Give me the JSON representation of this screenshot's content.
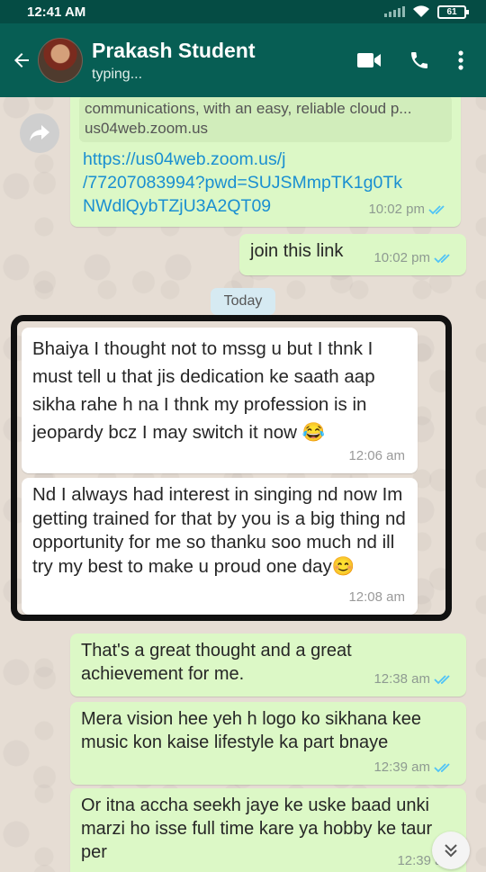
{
  "status_bar": {
    "time": "12:41 AM",
    "battery": "61"
  },
  "header": {
    "contact_name": "Prakash Student",
    "contact_status": "typing..."
  },
  "link_preview": {
    "description": "communications, with an easy, reliable cloud p...",
    "domain": "us04web.zoom.us"
  },
  "messages": [
    {
      "id": "link",
      "text_lines": [
        "https://us04web.zoom.us/j",
        "/77207083994?pwd=SUJSMmpTK1g0Tk",
        "NWdlQybTZjU3A2QT09"
      ],
      "time": "10:02 pm",
      "direction": "out"
    },
    {
      "id": "join",
      "text": "join this link",
      "time": "10:02 pm",
      "direction": "out"
    },
    {
      "id": "m1",
      "text": "Bhaiya I thought not to mssg u but I thnk I must tell u that jis dedication ke saath aap sikha rahe h na I thnk my profession is in jeopardy bcz I may switch it now 😂",
      "time": "12:06 am",
      "direction": "in"
    },
    {
      "id": "m2",
      "text": "Nd I always had interest in singing nd now Im getting trained for that by you is a big thing nd opportunity for me so thanku soo much nd ill try my best to make u proud one day😊",
      "time": "12:08 am",
      "direction": "in"
    },
    {
      "id": "m3",
      "text": "That's a great thought and a great achievement for me.",
      "time": "12:38 am",
      "direction": "out"
    },
    {
      "id": "m4",
      "text": "Mera vision hee yeh h logo ko sikhana kee music kon kaise lifestyle ka part bnaye",
      "time": "12:39 am",
      "direction": "out"
    },
    {
      "id": "m5",
      "text": "Or itna accha seekh jaye ke uske baad unki marzi ho isse full time kare ya hobby ke taur per",
      "time": "12:39 am",
      "direction": "out"
    }
  ],
  "date_chip": "Today",
  "colors": {
    "header": "#075e54",
    "status_bar": "#054c44",
    "outgoing": "#dcf8c6",
    "incoming": "#ffffff",
    "read_ticks": "#4fc3f7"
  },
  "icons": [
    "back-arrow-icon",
    "video-call-icon",
    "phone-icon",
    "more-vert-icon",
    "forward-icon",
    "double-check-icon",
    "scroll-down-icon"
  ]
}
